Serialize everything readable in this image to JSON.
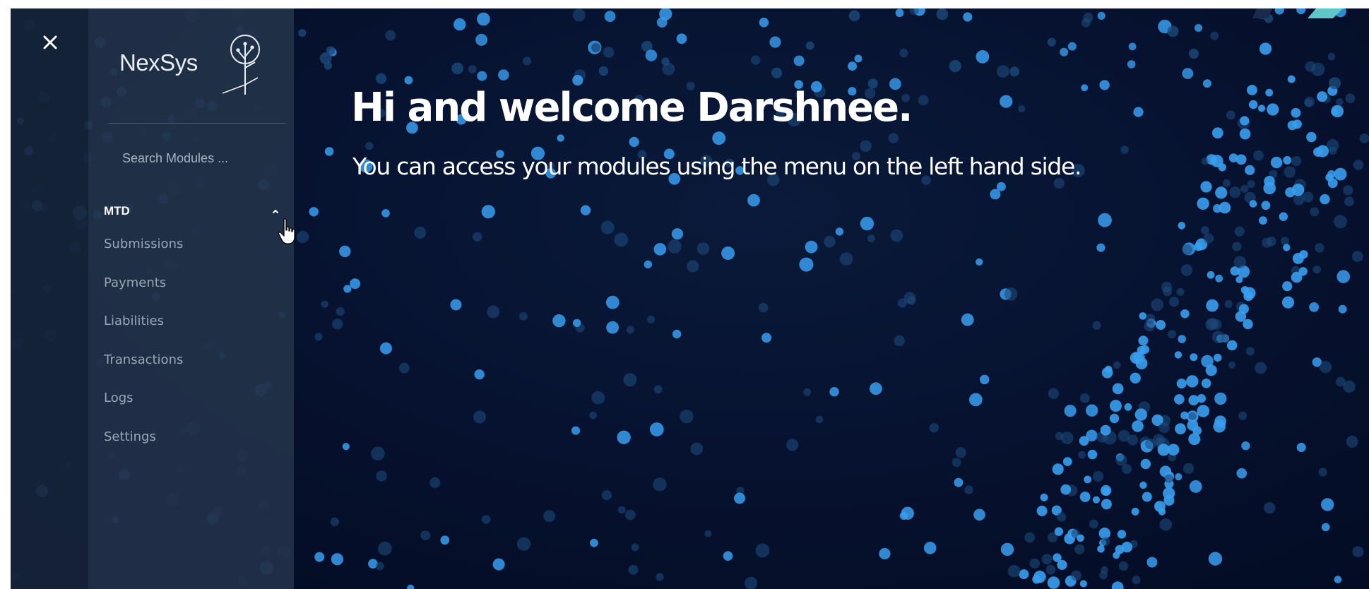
{
  "brand": {
    "logo_text": "NexSys",
    "accent": "#2f8fe0"
  },
  "search": {
    "placeholder": "Search Modules ..."
  },
  "sidebar": {
    "group_label": "MTD",
    "items": [
      {
        "label": "Submissions"
      },
      {
        "label": "Payments"
      },
      {
        "label": "Liabilities"
      },
      {
        "label": "Transactions"
      },
      {
        "label": "Logs"
      },
      {
        "label": "Settings"
      }
    ]
  },
  "main": {
    "title": "Hi and welcome Darshnee.",
    "subtitle": "You can access your modules using the menu on the left hand side."
  },
  "icons": {
    "close": "close-icon",
    "caret": "chevron-up-icon",
    "cursor": "hand-pointer-icon",
    "logo": "tree-icon"
  },
  "colors": {
    "background": "#061230",
    "rail": "#162438",
    "sidebar": "#213148",
    "menu_text": "#9aa6b6",
    "dot_light": "#3a9eee",
    "dot_dark": "#1c4a7a"
  }
}
